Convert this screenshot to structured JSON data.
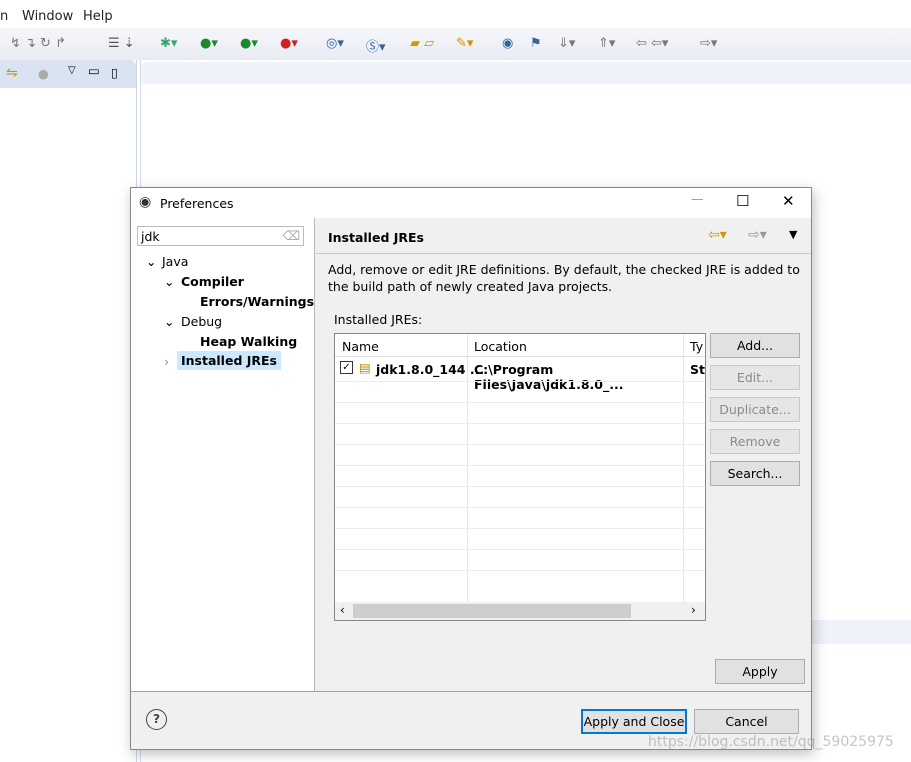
{
  "menubar": {
    "items": [
      "n",
      "Window",
      "Help"
    ]
  },
  "dialog": {
    "title": "Preferences",
    "filter": {
      "value": "jdk"
    },
    "tree": [
      {
        "label": "Java",
        "bold": false,
        "expanded": true
      },
      {
        "label": "Compiler",
        "bold": true,
        "expanded": true
      },
      {
        "label": "Errors/Warnings",
        "bold": true
      },
      {
        "label": "Debug",
        "bold": false,
        "expanded": true
      },
      {
        "label": "Heap Walking",
        "bold": true
      },
      {
        "label": "Installed JREs",
        "bold": true,
        "selected": true
      }
    ],
    "page": {
      "title": "Installed JREs",
      "description": "Add, remove or edit JRE definitions. By default, the checked JRE is added to the build path of newly created Java projects.",
      "table_label": "Installed JREs:",
      "columns": [
        "Name",
        "Location",
        "Ty"
      ],
      "rows": [
        {
          "checked": true,
          "name": "jdk1.8.0_144 ...",
          "location": "C:\\Program Files\\Java\\jdk1.8.0_...",
          "type": "St"
        }
      ],
      "buttons": {
        "add": "Add...",
        "edit": "Edit...",
        "duplicate": "Duplicate...",
        "remove": "Remove",
        "search": "Search..."
      },
      "apply": "Apply"
    },
    "footer": {
      "apply_close": "Apply and Close",
      "cancel": "Cancel"
    }
  },
  "watermark": "https://blog.csdn.net/qq_59025975",
  "colors": {
    "selection": "#cce8ff",
    "default_button_border": "#0078d7"
  }
}
